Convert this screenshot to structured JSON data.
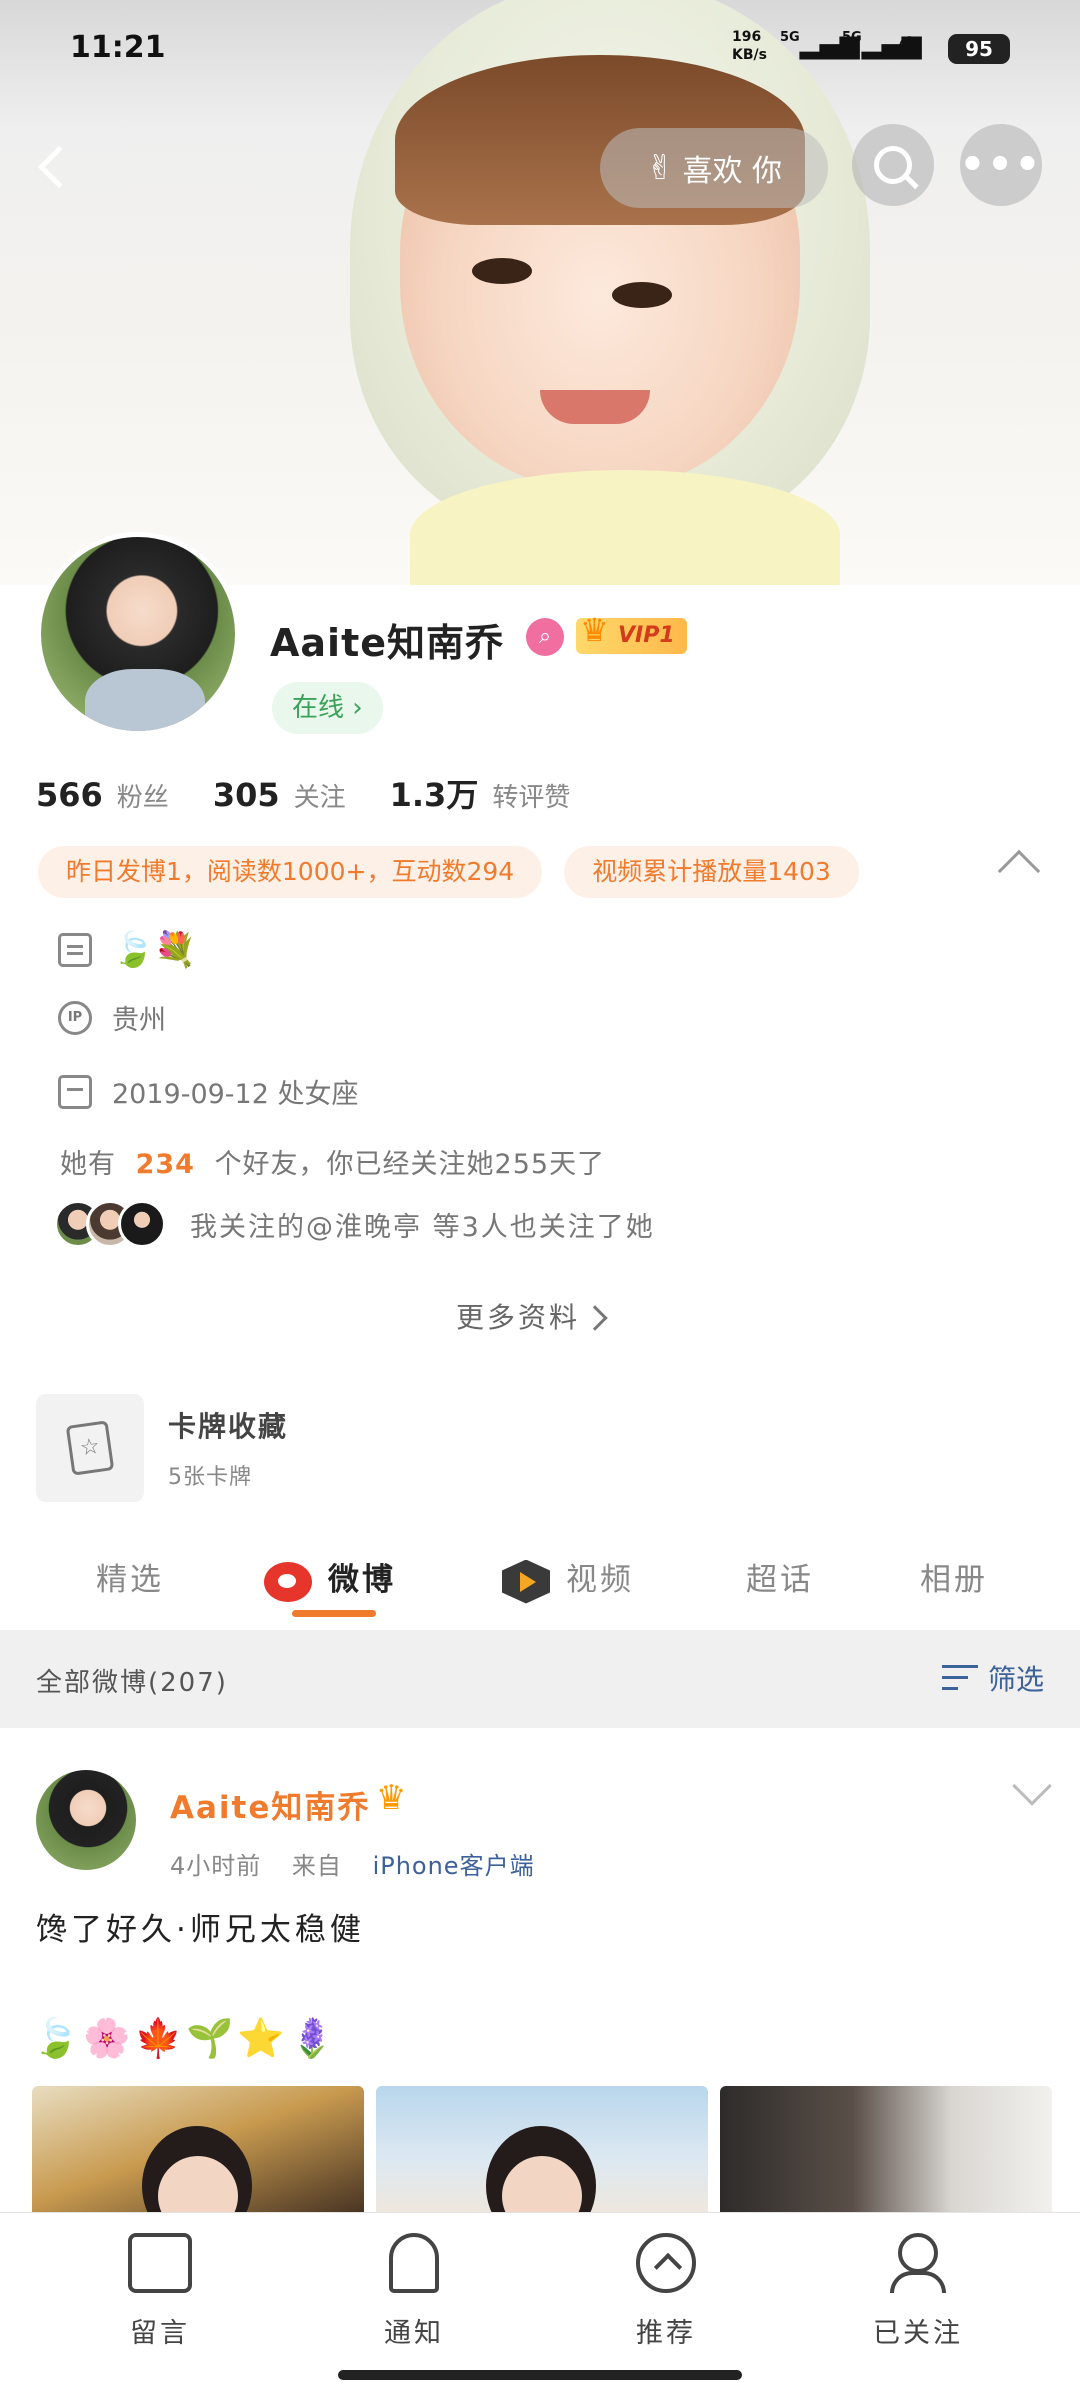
{
  "status_bar": {
    "time": "11:21",
    "net_speed": "196",
    "net_unit": "KB/s",
    "net1": "5G",
    "net2": "5G",
    "battery": "95"
  },
  "top_nav": {
    "like_label": "喜欢 你"
  },
  "profile": {
    "name": "Aaite知南乔",
    "vip": "VIP1",
    "online": "在线",
    "stats": [
      {
        "num": "566",
        "label": "粉丝"
      },
      {
        "num": "305",
        "label": "关注"
      },
      {
        "num": "1.3万",
        "label": "转评赞"
      }
    ],
    "chips": [
      "昨日发博1，阅读数1000+，互动数294",
      "视频累计播放量1403"
    ],
    "bio_emoji": "🍃💐",
    "location": "贵州",
    "birthday": "2019-09-12  处女座",
    "friends_prefix": "她有",
    "friends_count": "234",
    "friends_suffix": "个好友，你已经关注她255天了",
    "mutual_text": "我关注的@淮晚亭  等3人也关注了她",
    "more_label": "更多资料"
  },
  "cards": {
    "title": "卡牌收藏",
    "subtitle": "5张卡牌"
  },
  "tabs": [
    {
      "label": "精选"
    },
    {
      "label": "微博"
    },
    {
      "label": "视频"
    },
    {
      "label": "超话"
    },
    {
      "label": "相册"
    }
  ],
  "feed": {
    "all_label": "全部微博(207)",
    "filter_label": "筛选"
  },
  "post": {
    "author": "Aaite知南乔",
    "time": "4小时前",
    "from": "来自",
    "source": "iPhone客户端",
    "text": "馋了好久·师兄太稳健",
    "emoji_line": "🍃🌸🍁🌱⭐🪻"
  },
  "bottom_nav": [
    {
      "label": "留言",
      "icon": "message-icon"
    },
    {
      "label": "通知",
      "icon": "bell-icon"
    },
    {
      "label": "推荐",
      "icon": "recommend-icon"
    },
    {
      "label": "已关注",
      "icon": "followed-icon"
    }
  ],
  "colors": {
    "accent": "#f07b2c",
    "link": "#3d6199",
    "online": "#3aa35a"
  }
}
